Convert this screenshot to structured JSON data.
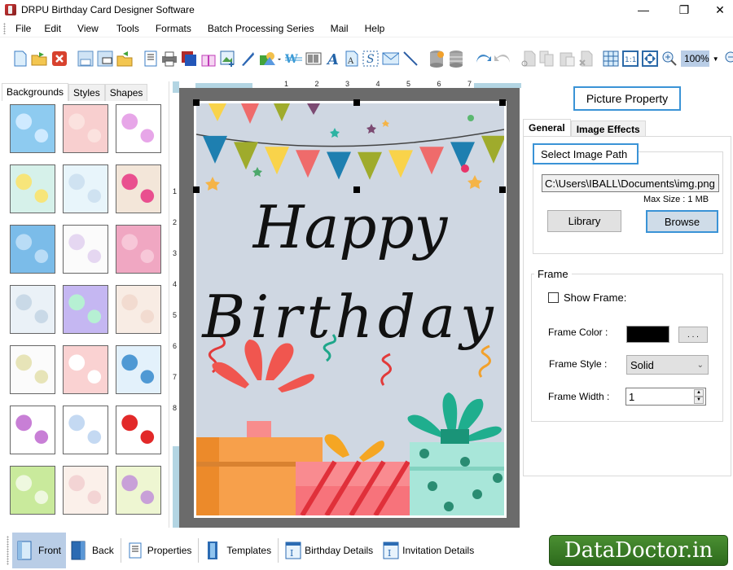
{
  "window": {
    "title": "DRPU Birthday Card Designer Software",
    "controls": {
      "minimize": "—",
      "maximize": "❐",
      "close": "✕"
    }
  },
  "menu": [
    "File",
    "Edit",
    "View",
    "Tools",
    "Formats",
    "Batch Processing Series",
    "Mail",
    "Help"
  ],
  "toolbar": {
    "groups": [
      [
        "new-icon",
        "open-icon",
        "close-file-icon"
      ],
      [
        "save-icon",
        "save-as-icon",
        "export-icon"
      ],
      [
        "print-preview-icon",
        "print-icon",
        "card-background-icon",
        "gift-icon",
        "insert-image-icon",
        "pen-icon",
        "shapes-icon",
        "wordart-icon",
        "barcode-icon",
        "text-icon",
        "text-document-icon",
        "signature-icon",
        "mail-icon",
        "line-icon"
      ],
      [
        "database-add-icon",
        "database-icon"
      ],
      [
        "undo-icon",
        "redo-icon"
      ],
      [
        "cut-icon",
        "copy-icon",
        "paste-icon",
        "delete-icon"
      ],
      [
        "grid-icon",
        "actual-size-icon",
        "fit-to-window-icon",
        "zoom-in-icon"
      ]
    ],
    "zoom_value": "100%",
    "zoom_out": "zoom-out-icon"
  },
  "left_panel": {
    "tabs": [
      "Backgrounds",
      "Styles",
      "Shapes"
    ],
    "active_tab": "Backgrounds",
    "thumbnails": [
      {
        "name": "sky-clouds",
        "color": "#8ecbf0",
        "color2": "#cfeaff"
      },
      {
        "name": "pink-hearts",
        "color": "#f8cfcf",
        "color2": "#fbe2df"
      },
      {
        "name": "butterflies",
        "color": "#fff",
        "color2": "#e7a6e8"
      },
      {
        "name": "flowers",
        "color": "#d6f1ea",
        "color2": "#f7e57a"
      },
      {
        "name": "bears-pastel",
        "color": "#e8f5fb",
        "color2": "#cfe2f1"
      },
      {
        "name": "bird-balloons",
        "color": "#f3e6d9",
        "color2": "#e94f8f"
      },
      {
        "name": "blue-stars",
        "color": "#7bbce9",
        "color2": "#b9dcf6"
      },
      {
        "name": "balloons-light",
        "color": "#fbfbfb",
        "color2": "#e5d7f1"
      },
      {
        "name": "pink-party",
        "color": "#f0a7c2",
        "color2": "#f7c7d8"
      },
      {
        "name": "bubbles",
        "color": "#eaf1f7",
        "color2": "#c9d9e7"
      },
      {
        "name": "rainbow-watercolor",
        "color": "#c5b7f2",
        "color2": "#b6f0d3"
      },
      {
        "name": "teddy-pastel",
        "color": "#f8ece4",
        "color2": "#f2dbd0"
      },
      {
        "name": "happy-birthday-text",
        "color": "#fbfbfb",
        "color2": "#e7e4b8"
      },
      {
        "name": "pink-stripes-hearts",
        "color": "#fad2d2",
        "color2": "#fff"
      },
      {
        "name": "colored-balloons",
        "color": "#e3f1fb",
        "color2": "#4f99d4"
      },
      {
        "name": "heart-outlines",
        "color": "#fff",
        "color2": "#c87fd6"
      },
      {
        "name": "balloon-bunches",
        "color": "#fff",
        "color2": "#c4d9f2"
      },
      {
        "name": "red-hearts",
        "color": "#fff",
        "color2": "#e22929"
      },
      {
        "name": "green-stripes",
        "color": "#c9ea9c",
        "color2": "#eef8df"
      },
      {
        "name": "cakes",
        "color": "#fbf0ea",
        "color2": "#f3d4d4"
      },
      {
        "name": "garden-confetti",
        "color": "#eef6d2",
        "color2": "#c8a0d8"
      }
    ]
  },
  "rulers": {
    "horizontal": [
      "1",
      "2",
      "3",
      "4",
      "5",
      "6",
      "7"
    ],
    "vertical": [
      "1",
      "2",
      "3",
      "4",
      "5",
      "6",
      "7",
      "8"
    ]
  },
  "card": {
    "line1": "Happy",
    "line2": "Birthday",
    "background": "#cfd7e2",
    "bunting_colors": [
      "#1e7fb0",
      "#9fab2c",
      "#f9d34a",
      "#ef6b6b",
      "#1e7fb0",
      "#9fab2c",
      "#f9d34a",
      "#ef6b6b",
      "#1e7fb0",
      "#9fab2c"
    ]
  },
  "right_panel": {
    "title": "Picture Property",
    "tabs": [
      "General",
      "Image Effects"
    ],
    "active_tab": "General",
    "image_path_group": "Select Image Path",
    "image_path_value": "C:\\Users\\IBALL\\Documents\\img.png",
    "max_size": "Max Size : 1 MB",
    "library_button": "Library",
    "browse_button": "Browse",
    "frame_group": "Frame",
    "show_frame_label": "Show Frame:",
    "show_frame_checked": false,
    "frame_color_label": "Frame Color :",
    "frame_color_value": "#000000",
    "frame_color_button": ". . .",
    "frame_style_label": "Frame Style :",
    "frame_style_value": "Solid",
    "frame_width_label": "Frame Width :",
    "frame_width_value": "1"
  },
  "bottom_tabs": [
    {
      "label": "Front",
      "icon": "front-page-icon",
      "active": true
    },
    {
      "label": "Back",
      "icon": "back-page-icon",
      "active": false
    },
    {
      "label": "Properties",
      "icon": "properties-icon",
      "active": false
    },
    {
      "label": "Templates",
      "icon": "templates-icon",
      "active": false
    },
    {
      "label": "Birthday Details",
      "icon": "birthday-details-icon",
      "active": false
    },
    {
      "label": "Invitation Details",
      "icon": "invitation-details-icon",
      "active": false
    }
  ],
  "brand": "DataDoctor.in"
}
